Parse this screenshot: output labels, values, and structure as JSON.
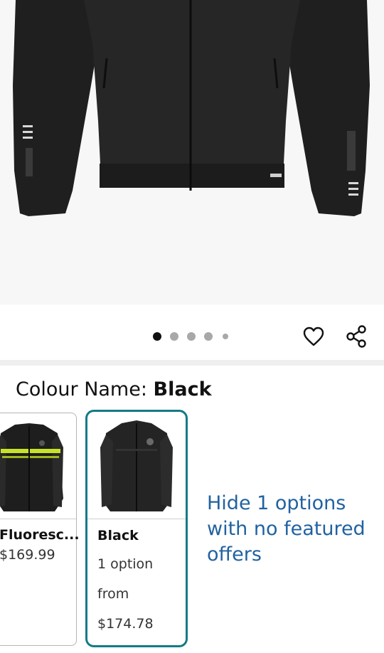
{
  "hero": {
    "pager": {
      "count": 5,
      "active_index": 0
    },
    "icons": {
      "wishlist": "heart-icon",
      "share": "share-icon"
    }
  },
  "colour": {
    "prefix": "Colour Name: ",
    "value": "Black"
  },
  "swatches": [
    {
      "name": "Fluoresc...",
      "price": "$169.99"
    },
    {
      "name": "Black",
      "options": "1 option",
      "from": "from",
      "price": "$174.78",
      "selected": true
    }
  ],
  "hide_link": "Hide 1 options with no featured offers",
  "colors": {
    "accent_border": "#137b87",
    "link": "#2162a1"
  }
}
